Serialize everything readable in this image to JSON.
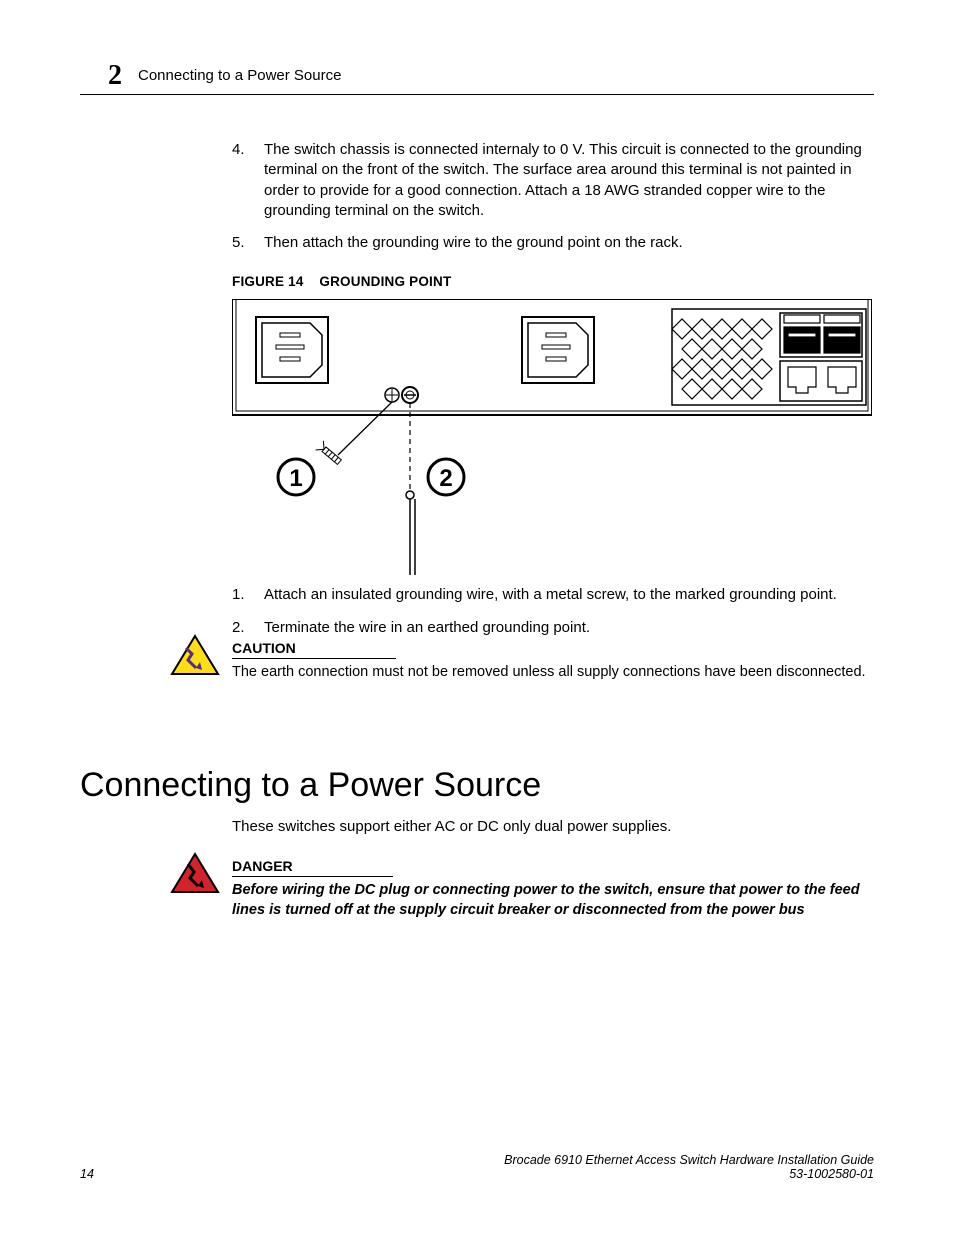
{
  "header": {
    "chapter_number": "2",
    "chapter_title": "Connecting to a Power Source"
  },
  "steps_a": [
    {
      "n": "4.",
      "t": "The switch chassis is connected internaly to 0 V. This circuit is connected to the grounding terminal on the front of the switch. The surface area around this terminal is not painted in order to provide for a good connection. Attach a 18 AWG stranded copper wire to the grounding terminal on the switch."
    },
    {
      "n": "5.",
      "t": "Then attach the grounding wire to the ground point on the rack."
    }
  ],
  "figure": {
    "label": "FIGURE 14",
    "title": "GROUNDING POINT",
    "callout_1": "1",
    "callout_2": "2"
  },
  "steps_b": [
    {
      "n": "1.",
      "t": "Attach an insulated grounding wire, with a metal screw, to the marked grounding point."
    },
    {
      "n": "2.",
      "t": "Terminate the wire in an earthed grounding point."
    }
  ],
  "caution": {
    "title": "CAUTION",
    "text": "The earth connection must not be removed unless all supply connections have been disconnected."
  },
  "section_heading": "Connecting to a Power Source",
  "section_intro": "These switches support either AC or DC only dual power supplies.",
  "danger": {
    "title": "DANGER",
    "text": "Before wiring the DC plug or connecting power to the switch, ensure that power to the feed lines is turned off at the supply circuit breaker or disconnected from the power bus"
  },
  "footer": {
    "page": "14",
    "line1": "Brocade 6910 Ethernet Access Switch Hardware Installation Guide",
    "line2": "53-1002580-01"
  }
}
